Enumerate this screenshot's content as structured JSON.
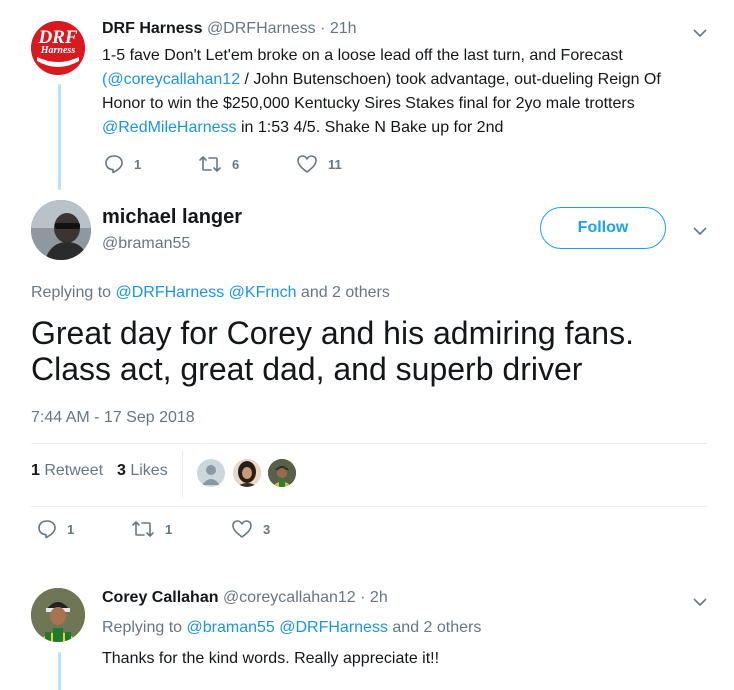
{
  "tweet1": {
    "avatar_text_top": "DRF",
    "avatar_text_bottom": "Harness",
    "name": "DRF Harness",
    "handle": "@DRFHarness",
    "time": "· 21h",
    "text_line1": "1-5 fave Don't Let'em broke on a loose lead off the last turn, and Forecast",
    "text_line2_link1": "(@coreycallahan12",
    "text_line2_rest": " / John Butenschoen) took advantage, out-dueling  Reign Of",
    "text_line3": "Honor to win the $250,000 Kentucky Sires Stakes final for 2yo male trotters",
    "text_line4_link": "@RedMileHarness",
    "text_line4_rest": " in 1:53 4/5. Shake N Bake up for 2nd",
    "replies": "1",
    "retweets": "6",
    "likes": "11"
  },
  "main_tweet": {
    "name": "michael langer",
    "handle": "@braman55",
    "follow_label": "Follow",
    "replying_prefix": "Replying to ",
    "replying_link1": "@DRFHarness",
    "replying_link2": "@KFrnch",
    "replying_suffix": " and 2 others",
    "text_line1": "Great day for Corey and his admiring fans.",
    "text_line2": "Class act, great dad, and superb driver",
    "timestamp": "7:44 AM - 17 Sep 2018",
    "retweet_count": "1",
    "retweet_label": " Retweet",
    "like_count": "3",
    "like_label": " Likes",
    "replies": "1",
    "retweets": "1",
    "likes": "3"
  },
  "reply_tweet": {
    "name": "Corey Callahan",
    "handle": "@coreycallahan12",
    "time": "· 2h",
    "replying_prefix": "Replying to ",
    "replying_link1": "@braman55",
    "replying_link2": "@DRFHarness",
    "replying_suffix": " and 2 others",
    "text": "Thanks for the kind words. Really appreciate it!!"
  },
  "colors": {
    "link": "#1b95e0",
    "muted": "#657786",
    "thread_line": "#b9e3fb",
    "drf_red": "#d71920"
  }
}
